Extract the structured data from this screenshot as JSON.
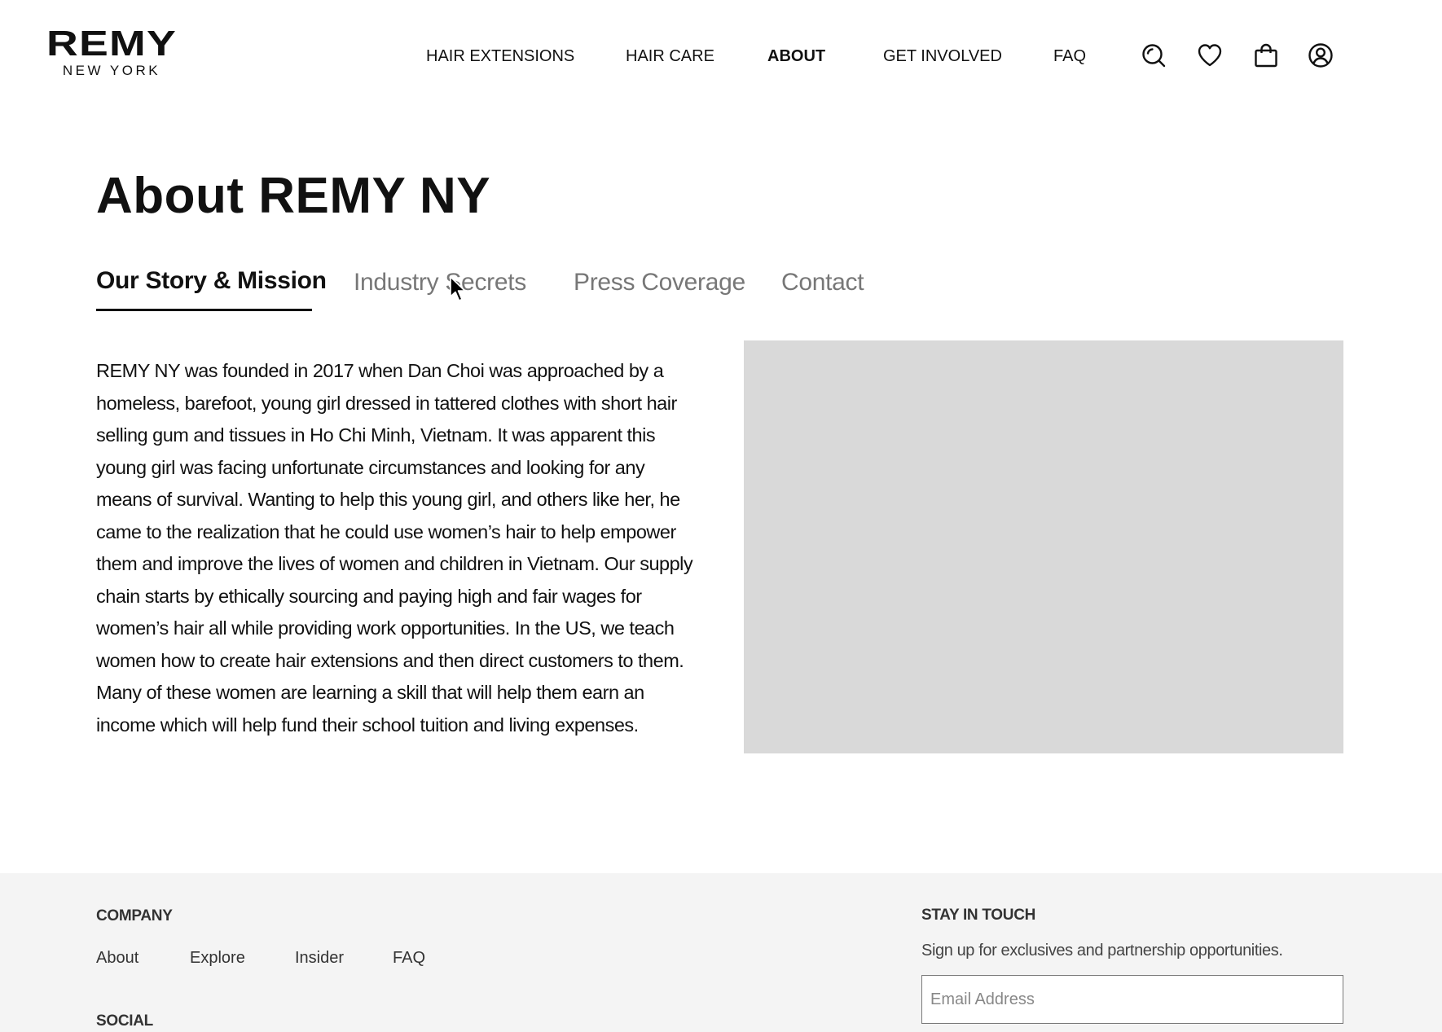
{
  "brand": {
    "name": "REMY",
    "subtitle": "NEW YORK"
  },
  "nav": {
    "items": [
      {
        "label": "HAIR EXTENSIONS",
        "active": false
      },
      {
        "label": "HAIR CARE",
        "active": false
      },
      {
        "label": "ABOUT",
        "active": true
      },
      {
        "label": "GET INVOLVED",
        "active": false
      },
      {
        "label": "FAQ",
        "active": false
      }
    ],
    "icons": [
      "search-icon",
      "heart-icon",
      "shopping-bag-icon",
      "account-icon"
    ]
  },
  "page": {
    "title": "About REMY NY"
  },
  "tabs": [
    {
      "label": "Our Story & Mission",
      "active": true
    },
    {
      "label": "Industry Secrets",
      "active": false
    },
    {
      "label": "Press Coverage",
      "active": false
    },
    {
      "label": "Contact",
      "active": false
    }
  ],
  "story": {
    "text": "REMY NY was founded in 2017 when Dan Choi was approached by a homeless, barefoot, young girl dressed in tattered clothes with short hair selling gum and tissues in Ho Chi Minh, Vietnam. It was apparent this young girl was facing unfortunate circumstances and looking for any means of survival. Wanting to help this young girl, and others like her, he came to the realization that he could use women’s hair to help empower them and improve the lives of women and children in Vietnam. Our supply chain starts by ethically sourcing and paying high and fair wages for women’s hair all while providing work opportunities. In the US, we teach women how to create hair extensions and then direct customers to them. Many of these women are learning a skill that will help them earn an income which will help fund their school tuition and living expenses."
  },
  "footer": {
    "company_heading": "COMPANY",
    "company_links": [
      "About",
      "Explore",
      "Insider",
      "FAQ"
    ],
    "social_heading": "SOCIAL",
    "stay_heading": "STAY IN TOUCH",
    "stay_text": "Sign up for exclusives and partnership opportunities.",
    "email_placeholder": "Email Address"
  },
  "colors": {
    "text": "#111111",
    "tab_inactive": "#777777",
    "image_placeholder": "#d9d9d9",
    "footer_bg": "#f4f4f4"
  }
}
